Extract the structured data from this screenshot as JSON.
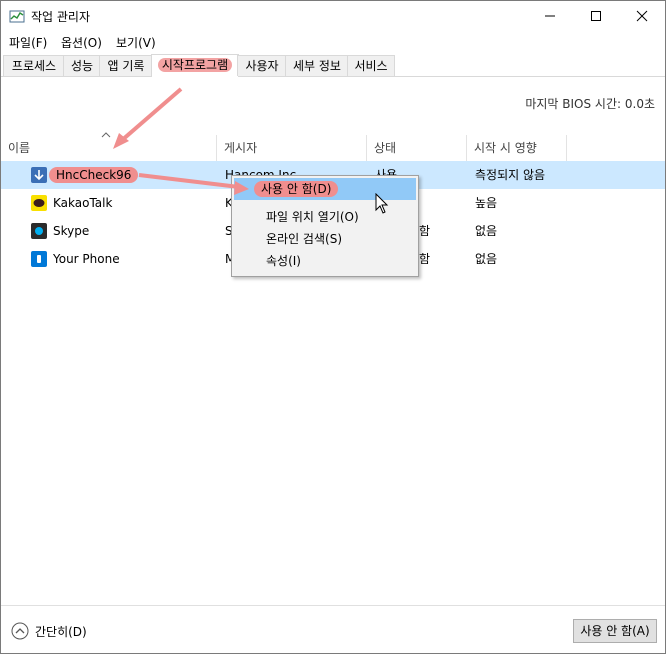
{
  "window": {
    "title": "작업 관리자",
    "minimize_icon": "minimize-icon",
    "maximize_icon": "maximize-icon",
    "close_icon": "close-icon"
  },
  "menubar": {
    "items": [
      "파일(F)",
      "옵션(O)",
      "보기(V)"
    ]
  },
  "tabs": {
    "items": [
      "프로세스",
      "성능",
      "앱 기록",
      "시작프로그램",
      "사용자",
      "세부 정보",
      "서비스"
    ],
    "active_index": 3
  },
  "bios": {
    "label": "마지막 BIOS 시간:",
    "value": "0.0초"
  },
  "table": {
    "columns": [
      "이름",
      "게시자",
      "상태",
      "시작 시 영향"
    ],
    "rows": [
      {
        "name": "HncCheck96",
        "publisher": "Hancom Inc.",
        "status": "사용",
        "impact": "측정되지 않음",
        "icon": "download-arrow-icon",
        "selected": true
      },
      {
        "name": "KakaoTalk",
        "publisher": "K",
        "status": "",
        "impact": "높음",
        "icon": "kakaotalk-icon",
        "selected": false
      },
      {
        "name": "Skype",
        "publisher": "S",
        "status": "함",
        "impact": "없음",
        "icon": "skype-icon",
        "selected": false
      },
      {
        "name": "Your Phone",
        "publisher": "M",
        "status": "함",
        "impact": "없음",
        "icon": "your-phone-icon",
        "selected": false
      }
    ]
  },
  "context_menu": {
    "items": [
      "사용 안 함(D)",
      "파일 위치 열기(O)",
      "온라인 검색(S)",
      "속성(I)"
    ],
    "highlighted_index": 0
  },
  "footer": {
    "fewer_details": "간단히(D)",
    "disable_button": "사용 안 함(A)"
  },
  "colors": {
    "annotation": "#f08e8e",
    "selection": "#cce8ff",
    "menu_hot": "#91c9f7"
  }
}
